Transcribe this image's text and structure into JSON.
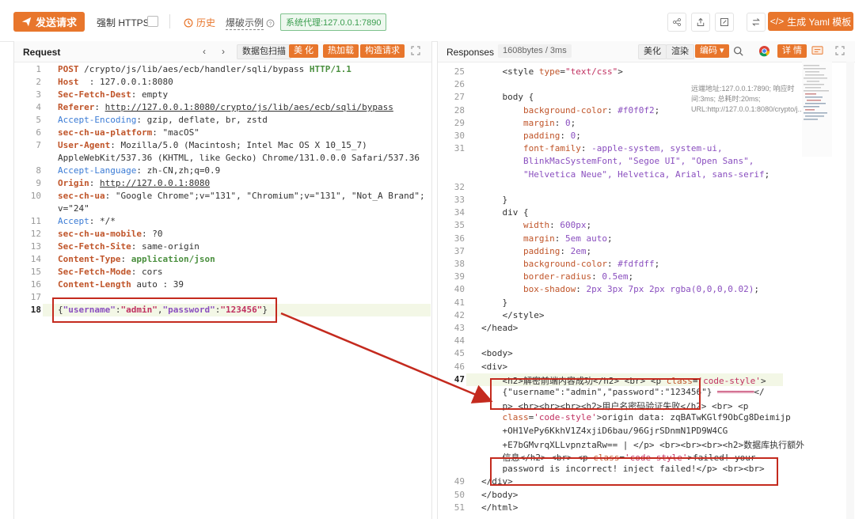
{
  "toolbar": {
    "send_label": "发送请求",
    "https_label": "强制 HTTPS",
    "history_label": "历史",
    "brute_label": "爆破示例",
    "proxy_label": "系统代理:127.0.0.1:7890",
    "yaml_label": "生成 Yaml 模板",
    "accent_color": "#e8762c"
  },
  "request": {
    "title": "Request",
    "buttons": [
      "数据包扫描",
      "美 化",
      "热加载",
      "构造请求"
    ],
    "lines": [
      {
        "n": "1",
        "parts": [
          [
            "meth",
            "POST"
          ],
          [
            "hval",
            " /crypto/js/lib/aes/ecb/handler/sqli/bypass "
          ],
          [
            "httpv",
            "HTTP/1.1"
          ]
        ]
      },
      {
        "n": "2",
        "parts": [
          [
            "hkey",
            "Host"
          ],
          [
            "hval",
            "  : 127.0.0.1:8080"
          ]
        ]
      },
      {
        "n": "3",
        "parts": [
          [
            "hkey",
            "Sec-Fetch-Dest"
          ],
          [
            "hval",
            ": empty"
          ]
        ]
      },
      {
        "n": "4",
        "parts": [
          [
            "hkey",
            "Referer"
          ],
          [
            "hval",
            ": "
          ],
          [
            "ulink",
            "http://127.0.0.1:8080/crypto/js/lib/aes/ecb/sqli/bypass"
          ]
        ]
      },
      {
        "n": "5",
        "parts": [
          [
            "hkey2",
            "Accept-Encoding"
          ],
          [
            "hval",
            ": gzip, deflate, br, zstd"
          ]
        ]
      },
      {
        "n": "6",
        "parts": [
          [
            "hkey",
            "sec-ch-ua-platform"
          ],
          [
            "hval",
            ": \"macOS\""
          ]
        ]
      },
      {
        "n": "7",
        "parts": [
          [
            "hkey",
            "User-Agent"
          ],
          [
            "hval",
            ": Mozilla/5.0 (Macintosh; Intel Mac OS X 10_15_7)"
          ]
        ]
      },
      {
        "n": "",
        "parts": [
          [
            "hval",
            "AppleWebKit/537.36 (KHTML, like Gecko) Chrome/131.0.0.0 Safari/537.36"
          ]
        ]
      },
      {
        "n": "8",
        "parts": [
          [
            "hkey2",
            "Accept-Language"
          ],
          [
            "hval",
            ": zh-CN,zh;q=0.9"
          ]
        ]
      },
      {
        "n": "9",
        "parts": [
          [
            "hkey",
            "Origin"
          ],
          [
            "hval",
            ": "
          ],
          [
            "ulink",
            "http://127.0.0.1:8080"
          ]
        ]
      },
      {
        "n": "10",
        "parts": [
          [
            "hkey",
            "sec-ch-ua"
          ],
          [
            "hval",
            ": \"Google Chrome\";v=\"131\", \"Chromium\";v=\"131\", \"Not_A Brand\";"
          ]
        ]
      },
      {
        "n": "",
        "parts": [
          [
            "hval",
            "v=\"24\""
          ]
        ]
      },
      {
        "n": "11",
        "parts": [
          [
            "hkey2",
            "Accept"
          ],
          [
            "hval",
            ": */*"
          ]
        ]
      },
      {
        "n": "12",
        "parts": [
          [
            "hkey",
            "sec-ch-ua-mobile"
          ],
          [
            "hval",
            ": ?0"
          ]
        ]
      },
      {
        "n": "13",
        "parts": [
          [
            "hkey",
            "Sec-Fetch-Site"
          ],
          [
            "hval",
            ": same-origin"
          ]
        ]
      },
      {
        "n": "14",
        "parts": [
          [
            "hkey",
            "Content-Type"
          ],
          [
            "hval",
            ": "
          ],
          [
            "httpv",
            "application/json"
          ]
        ]
      },
      {
        "n": "15",
        "parts": [
          [
            "hkey",
            "Sec-Fetch-Mode"
          ],
          [
            "hval",
            ": cors"
          ]
        ]
      },
      {
        "n": "16",
        "parts": [
          [
            "hkey",
            "Content-Length"
          ],
          [
            "hval",
            " auto : 39"
          ]
        ]
      },
      {
        "n": "17",
        "parts": [
          [
            "hval",
            ""
          ]
        ]
      },
      {
        "n": "18",
        "parts": [
          [
            "hval",
            "{"
          ],
          [
            "jkey",
            "\"username\""
          ],
          [
            "hval",
            ":"
          ],
          [
            "jval",
            "\"admin\""
          ],
          [
            "hval",
            ","
          ],
          [
            "jkey",
            "\"password\""
          ],
          [
            "hval",
            ":"
          ],
          [
            "jval",
            "\"123456\""
          ],
          [
            "hval",
            "}"
          ]
        ]
      }
    ]
  },
  "response": {
    "title": "Responses",
    "size_info": "1608bytes / 3ms",
    "buttons": [
      "美化",
      "渲染",
      "编码",
      "详 情"
    ],
    "meta": "远端地址:127.0.0.1:7890; 响应时间:3ms; 总耗时:20ms; URL:http://127.0.0.1:8080/crypto/j...",
    "lines": [
      {
        "n": "25",
        "parts": [
          [
            "tag",
            "    <style "
          ],
          [
            "attr",
            "type"
          ],
          [
            "tag",
            "="
          ],
          [
            "str",
            "\"text/css\""
          ],
          [
            "tag",
            ">"
          ]
        ]
      },
      {
        "n": "26",
        "parts": [
          [
            "tag",
            ""
          ]
        ]
      },
      {
        "n": "27",
        "parts": [
          [
            "tag",
            "    body {"
          ]
        ]
      },
      {
        "n": "28",
        "parts": [
          [
            "prop",
            "        background-color"
          ],
          [
            "tag",
            ": "
          ],
          [
            "pval",
            "#f0f0f2"
          ],
          [
            "tag",
            ";"
          ]
        ]
      },
      {
        "n": "29",
        "parts": [
          [
            "prop",
            "        margin"
          ],
          [
            "tag",
            ": "
          ],
          [
            "pval",
            "0"
          ],
          [
            "tag",
            ";"
          ]
        ]
      },
      {
        "n": "30",
        "parts": [
          [
            "prop",
            "        padding"
          ],
          [
            "tag",
            ": "
          ],
          [
            "pval",
            "0"
          ],
          [
            "tag",
            ";"
          ]
        ]
      },
      {
        "n": "31",
        "parts": [
          [
            "prop",
            "        font-family"
          ],
          [
            "tag",
            ": "
          ],
          [
            "pval",
            "-apple-system, system-ui,"
          ]
        ]
      },
      {
        "n": "",
        "parts": [
          [
            "pval",
            "        BlinkMacSystemFont, \"Segoe UI\", \"Open Sans\","
          ]
        ]
      },
      {
        "n": "",
        "parts": [
          [
            "pval",
            "        \"Helvetica Neue\", Helvetica, Arial, sans-serif"
          ],
          [
            "tag",
            ";"
          ]
        ]
      },
      {
        "n": "32",
        "parts": [
          [
            "tag",
            ""
          ]
        ]
      },
      {
        "n": "33",
        "parts": [
          [
            "tag",
            "    }"
          ]
        ]
      },
      {
        "n": "34",
        "parts": [
          [
            "tag",
            "    div {"
          ]
        ]
      },
      {
        "n": "35",
        "parts": [
          [
            "prop",
            "        width"
          ],
          [
            "tag",
            ": "
          ],
          [
            "pval",
            "600px"
          ],
          [
            "tag",
            ";"
          ]
        ]
      },
      {
        "n": "36",
        "parts": [
          [
            "prop",
            "        margin"
          ],
          [
            "tag",
            ": "
          ],
          [
            "pval",
            "5em auto"
          ],
          [
            "tag",
            ";"
          ]
        ]
      },
      {
        "n": "37",
        "parts": [
          [
            "prop",
            "        padding"
          ],
          [
            "tag",
            ": "
          ],
          [
            "pval",
            "2em"
          ],
          [
            "tag",
            ";"
          ]
        ]
      },
      {
        "n": "38",
        "parts": [
          [
            "prop",
            "        background-color"
          ],
          [
            "tag",
            ": "
          ],
          [
            "pval",
            "#fdfdff"
          ],
          [
            "tag",
            ";"
          ]
        ]
      },
      {
        "n": "39",
        "parts": [
          [
            "prop",
            "        border-radius"
          ],
          [
            "tag",
            ": "
          ],
          [
            "pval",
            "0.5em"
          ],
          [
            "tag",
            ";"
          ]
        ]
      },
      {
        "n": "40",
        "parts": [
          [
            "prop",
            "        box-shadow"
          ],
          [
            "tag",
            ": "
          ],
          [
            "pval",
            "2px 3px 7px 2px rgba(0,0,0,0.02)"
          ],
          [
            "tag",
            ";"
          ]
        ]
      },
      {
        "n": "41",
        "parts": [
          [
            "tag",
            "    }"
          ]
        ]
      },
      {
        "n": "42",
        "parts": [
          [
            "tag",
            "    </style>"
          ]
        ]
      },
      {
        "n": "43",
        "parts": [
          [
            "tag",
            "</head>"
          ]
        ]
      },
      {
        "n": "44",
        "parts": [
          [
            "tag",
            ""
          ]
        ]
      },
      {
        "n": "45",
        "parts": [
          [
            "tag",
            "<body>"
          ]
        ]
      },
      {
        "n": "46",
        "parts": [
          [
            "tag",
            "<div>"
          ]
        ]
      },
      {
        "n": "47",
        "parts": [
          [
            "tag",
            "    <h2>解密前端内容成功</h2> <br> <p "
          ],
          [
            "attr",
            "class"
          ],
          [
            "tag",
            "="
          ],
          [
            "str",
            "'code-style'"
          ],
          [
            "tag",
            ">"
          ]
        ]
      },
      {
        "n": "",
        "parts": [
          [
            "tag",
            "    {\"username\":\"admin\",\"password\":\"123456\"}"
          ],
          [
            "str",
            " ═══════"
          ],
          [
            "tag",
            "</"
          ]
        ]
      },
      {
        "n": "",
        "parts": [
          [
            "tag",
            "    p> <br><br><br><h2>用户名密码验证失败</h2> <br> <p"
          ]
        ]
      },
      {
        "n": "",
        "parts": [
          [
            "attr",
            "    class"
          ],
          [
            "tag",
            "="
          ],
          [
            "str",
            "'code-style'"
          ],
          [
            "tag",
            ">origin data: zqBATwKGlf9ObCg8Deimijp"
          ]
        ]
      },
      {
        "n": "",
        "parts": [
          [
            "tag",
            "    +OH1VePy6KkhV1Z4xjiD6bau/96GjrSDnmN1PD9W4CG"
          ]
        ]
      },
      {
        "n": "",
        "parts": [
          [
            "tag",
            "    +E7bGMvrqXLLvpnztaRw== | </p> <br><br><br><h2>数据库执行额外"
          ]
        ]
      },
      {
        "n": "",
        "parts": [
          [
            "tag",
            "    信息</h2> <br> <p "
          ],
          [
            "attr",
            "class"
          ],
          [
            "tag",
            "="
          ],
          [
            "str",
            "'code-style'"
          ],
          [
            "tag",
            ">failed! your"
          ]
        ]
      },
      {
        "n": "",
        "parts": [
          [
            "tag",
            "    password is incorrect! inject failed!</p> <br><br>"
          ]
        ]
      },
      {
        "n": "49",
        "parts": [
          [
            "tag",
            "</div>"
          ]
        ]
      },
      {
        "n": "50",
        "parts": [
          [
            "tag",
            "</body>"
          ]
        ]
      },
      {
        "n": "51",
        "parts": [
          [
            "tag",
            "</html>"
          ]
        ]
      }
    ]
  }
}
